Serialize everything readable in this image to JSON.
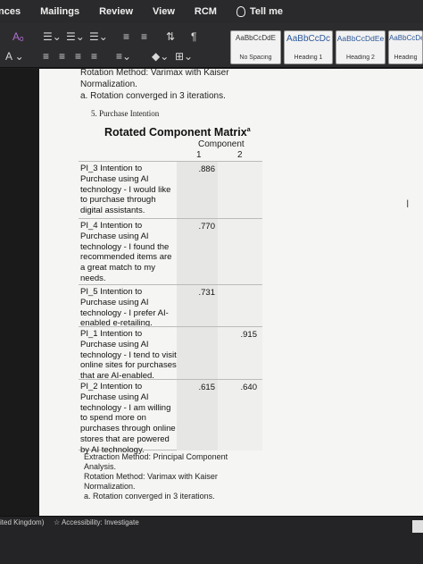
{
  "ribbon": {
    "tabs": [
      "nces",
      "Mailings",
      "Review",
      "View",
      "RCM"
    ],
    "tell_me": "Tell me",
    "styles": [
      {
        "sample": "AaBbCcDdE",
        "label": "No Spacing"
      },
      {
        "sample": "AaBbCcDc",
        "label": "Heading 1"
      },
      {
        "sample": "AaBbCcDdEe",
        "label": "Heading 2"
      },
      {
        "sample": "AaBbCcDe",
        "label": "Heading"
      }
    ]
  },
  "document": {
    "top_lines": [
      "Rotation Method: Varimax with Kaiser",
      "Normalization.",
      "a. Rotation converged in 3 iterations."
    ],
    "item_heading": "5.    Purchase Intention",
    "matrix_title": "Rotated Component Matrix",
    "matrix_superscript": "a",
    "component_label": "Component",
    "columns": [
      "1",
      "2"
    ],
    "rows": [
      {
        "label": "PI_3 Intention to Purchase using AI technology - I would like to purchase through digital assistants.",
        "c1": ".886",
        "c2": ""
      },
      {
        "label": "PI_4 Intention to Purchase using AI technology - I found the recommended items are a great match to my needs.",
        "c1": ".770",
        "c2": ""
      },
      {
        "label": "PI_5 Intention to Purchase using AI technology - I prefer AI-enabled e-retailing.",
        "c1": ".731",
        "c2": ""
      },
      {
        "label": "PI_1 Intention to Purchase using AI technology - I tend to visit online sites for purchases that are AI-enabled.",
        "c1": "",
        "c2": ".915"
      },
      {
        "label": "PI_2 Intention to Purchase using AI technology - I am willing to spend more on purchases through online stores that are powered by AI technology.",
        "c1": ".615",
        "c2": ".640"
      }
    ],
    "footnotes": [
      "Extraction Method: Principal Component",
      "Analysis.",
      " Rotation Method: Varimax with Kaiser",
      "Normalization.",
      "a. Rotation converged in 3 iterations."
    ]
  },
  "status": {
    "language": "ited Kingdom)",
    "accessibility": "Accessibility: Investigate"
  }
}
